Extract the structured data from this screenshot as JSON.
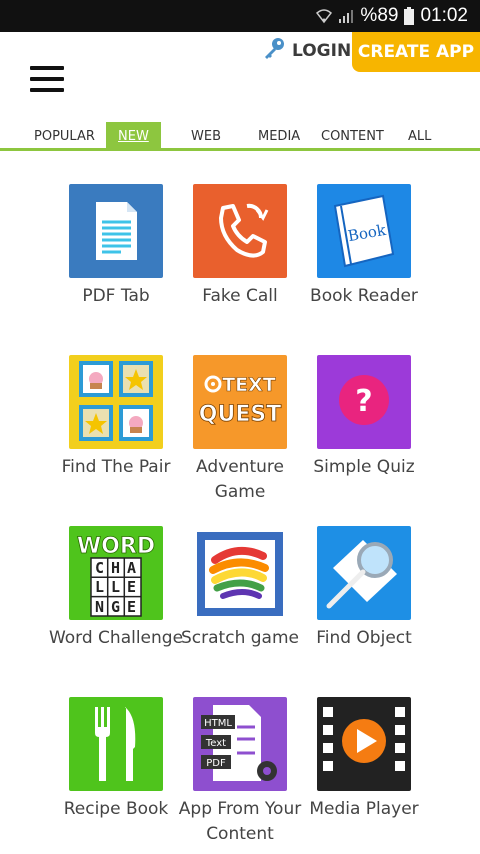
{
  "status_bar": {
    "battery": "%89",
    "time": "01:02"
  },
  "header": {
    "login_label": "LOGIN",
    "create_app_label": "CREATE APP"
  },
  "tabs": [
    {
      "label": "POPULAR"
    },
    {
      "label": "NEW",
      "active": true
    },
    {
      "label": "WEB"
    },
    {
      "label": "MEDIA"
    },
    {
      "label": "CONTENT"
    },
    {
      "label": "ALL"
    }
  ],
  "apps": [
    {
      "label": "PDF Tab",
      "icon": "pdf-document-icon",
      "color": "#3a7bbf"
    },
    {
      "label": "Fake Call",
      "icon": "phone-call-icon",
      "color": "#e9602d"
    },
    {
      "label": "Book Reader",
      "icon": "book-icon",
      "icon_text": "Book",
      "color": "#1e88e5"
    },
    {
      "label": "Find The Pair",
      "icon": "memory-cards-icon",
      "color": "#f2cf1d"
    },
    {
      "label": "Adventure Game",
      "icon": "text-quest-icon",
      "icon_text_1": "TEXT",
      "icon_text_2": "QUEST",
      "color": "#f6982a"
    },
    {
      "label": "Simple Quiz",
      "icon": "question-mark-icon",
      "icon_text": "?",
      "color": "#9c3ad9"
    },
    {
      "label": "Word Challenge",
      "icon": "word-grid-icon",
      "icon_text": "WORD",
      "grid_rows": [
        "CHA",
        "LLE",
        "NGE"
      ],
      "color": "#4fc41c"
    },
    {
      "label": "Scratch game",
      "icon": "scratch-card-icon",
      "color": "#3a6dbf"
    },
    {
      "label": "Find Object",
      "icon": "magnifier-icon",
      "color": "#1e8fe5"
    },
    {
      "label": "Recipe Book",
      "icon": "fork-knife-icon",
      "color": "#4fc41c"
    },
    {
      "label": "App From Your Content",
      "icon": "content-file-icon",
      "icon_tags": [
        "HTML",
        "Text",
        "PDF"
      ],
      "color": "#8e4fcf"
    },
    {
      "label": "Media Player",
      "icon": "film-play-icon",
      "color": "#222222"
    }
  ]
}
